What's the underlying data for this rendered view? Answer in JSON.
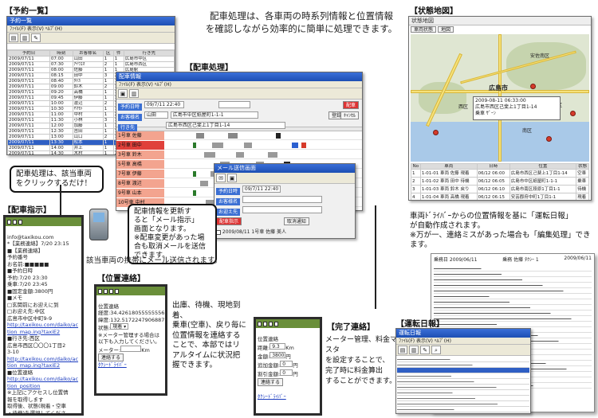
{
  "headline": {
    "line1": "配車処理は、各車両の時系列情報と位置情報",
    "line2": "を確認しながら効率的に簡単に処理できます。"
  },
  "sections": {
    "reservation_list": "【予約一覧】",
    "dispatch": "【配車処理】",
    "status_map": "【状態地図】",
    "dispatch_instruction": "【配車指示】",
    "location_contact": "【位置連絡】",
    "completion_contact": "【完了連絡】",
    "driving_log": "【運転日報】"
  },
  "reservation_window": {
    "title": "予約一覧",
    "menu": "ﾌｧｲﾙ(F) 表示(V) ﾍﾙﾌﾟ(H)",
    "columns": [
      "予約日",
      "時刻",
      "お客様名",
      "区",
      "件",
      "行き先"
    ],
    "rows": [
      [
        "2009/07/11",
        "07:00",
        "山田",
        "1",
        "1",
        "広島市中区"
      ],
      [
        "2009/07/11",
        "07:30",
        "ｱｲｳｴｵ",
        "2",
        "1",
        "広島市西区"
      ],
      [
        "2009/07/11",
        "08:00",
        "佐藤",
        "1",
        "1",
        "広島駅"
      ],
      [
        "2009/07/11",
        "08:15",
        "田中",
        "3",
        "2",
        "広島市南区"
      ],
      [
        "2009/07/11",
        "08:40",
        "ﾀﾅｶ",
        "1",
        "1",
        "広島市東区"
      ],
      [
        "2009/07/11",
        "09:00",
        "鈴木",
        "2",
        "1",
        "広島市中区"
      ],
      [
        "2009/07/11",
        "09:20",
        "高橋",
        "1",
        "1",
        "広島市安佐南区"
      ],
      [
        "2009/07/11",
        "09:45",
        "伊藤",
        "1",
        "1",
        "広島市西区"
      ],
      [
        "2009/07/11",
        "10:00",
        "渡辺",
        "2",
        "1",
        "広島市中区"
      ],
      [
        "2009/07/11",
        "10:30",
        "ﾔﾏﾓﾄ",
        "1",
        "1",
        "広島市南区"
      ],
      [
        "2009/07/11",
        "11:00",
        "中村",
        "1",
        "2",
        "広島市中区"
      ],
      [
        "2009/07/11",
        "11:30",
        "小林",
        "3",
        "1",
        "広島市東区"
      ],
      [
        "2009/07/11",
        "12:00",
        "加藤",
        "1",
        "1",
        "広島駅"
      ],
      [
        "2009/07/11",
        "12:30",
        "吉田",
        "1",
        "1",
        "広島市西区"
      ],
      [
        "2009/07/11",
        "13:00",
        "山口",
        "2",
        "1",
        "広島市中区"
      ],
      [
        "2009/07/11",
        "13:30",
        "松本",
        "1",
        "1",
        "広島市南区"
      ],
      [
        "2009/07/11",
        "14:00",
        "井上",
        "1",
        "1",
        "広島市中区"
      ],
      [
        "2009/07/11",
        "14:30",
        "木村",
        "1",
        "2",
        "広島市安佐北区"
      ]
    ]
  },
  "dispatch_window": {
    "title": "配車情報",
    "menu": "ﾌｧｲﾙ(F) 表示(V) ﾍﾙﾌﾟ(H)",
    "date_label": "予約日時",
    "date_value": "09/7/11 22:40",
    "field_customer": "お客様名",
    "field_from": "お迎え先",
    "field_to": "行き先",
    "customer_value": "山田",
    "from_value": "広島市中区紙屋町1-1-1",
    "to_value": "広島市西区己斐上1丁目1-14",
    "btn_dispatch": "配車",
    "btn_save": "登録",
    "btn_cancel": "ｷｬﾝｾﾙ",
    "vehicles": [
      "1号車 佐藤",
      "2号車 田中",
      "3号車 鈴木",
      "5号車 高橋",
      "7号車 伊藤",
      "8号車 渡辺",
      "9号車 山本",
      "10号車 中村"
    ]
  },
  "mail_window": {
    "title": "メール送信画面",
    "date_label": "予約日時",
    "date_value": "09/7/11 22:40",
    "customer_label": "お客様名",
    "from_label": "お迎え先",
    "to_label": "行き先",
    "send_button": "配車指示",
    "cancel_button": "取消通知",
    "recipient": "2009/08/11 1号車 佐藤 美人"
  },
  "callout_click": {
    "line1": "配車処理は、該当車両",
    "line2": "をクリックするだけ！"
  },
  "callout_mail": {
    "line1": "配車情報を更新す",
    "line2": "ると「メール指示」",
    "line3": "画面となります。",
    "line4": "※配車変更があった場",
    "line5": "合も取消メールを送信",
    "line6": "できます。"
  },
  "phone_send_note": "該当車両の携帯にメール送信されます。",
  "phone_instruction": {
    "sender": "info@taxikou.com",
    "date": "*【業務連絡】7/20 23:15",
    "body": "■【業務連絡】\n予約番号\nお名前:■■■■■\n■予約日時\n予約:7/20 23:30\n乗車:7/20 23:45\n■固定金額:3800円\n■メモ\n□玄関前にお迎えに到\n□お迎え先:中区\n広島市中区中町9-9",
    "link1": "http://taxikou.com/daiko/action_map.ing?taxiE2",
    "note1": "■行き先:西区\n広島市西区〇〇〇1丁目2\n3-10\n",
    "link2": "http://taxikou.com/daiko/action_map.ing?taxiE2",
    "note2": "■位置連絡\n",
    "link3": "http://taxikou.com/daiko/action_position",
    "note3": "※上記にアクセスし位置情\n報を取得します\n取得後、状態(現着・空車\n・待機)を選択してくださ"
  },
  "phone_location": {
    "title": "位置連絡",
    "coords": "経度:34.42618055555556\n緯度:132.5172247906887",
    "status_label": "状態:",
    "status_value": "現着",
    "note": "※メーター管理する場合は\n以下も入力してください。",
    "meter_label": "メーター:",
    "meter_unit": "Km",
    "send": "連絡する",
    "footer": "ﾀｸｼｰﾄﾞﾗｲﾊﾞｰ"
  },
  "location_desc": {
    "line1": "出庫、待機、現地到着、",
    "line2": "乗車(空車)、戻り毎に",
    "line3": "位置情報を連絡する",
    "line4": "ことで、本部ではリ",
    "line5": "アルタイムに状況把",
    "line6": "握できます。"
  },
  "phone_complete": {
    "title": "位置連絡",
    "distance_label": "距離:",
    "distance_value": "9.3",
    "distance_unit": "Km",
    "fare_label": "金額:",
    "fare_value": "3800",
    "fare_unit": "円",
    "extra_label": "追加金額:",
    "extra_value": "0",
    "extra_unit": "円",
    "discount_label": "割引金額:",
    "discount_value": "0",
    "discount_unit": "円",
    "send": "連絡する",
    "footer": "ﾀｸｼｰﾄﾞﾗｲﾊﾞｰ"
  },
  "complete_desc": {
    "line1": "メーター管理、料金マスタ",
    "line2": "を設定することで、",
    "line3": "完了時に料金算出",
    "line4": "することができます。"
  },
  "map_window": {
    "title": "状態地図",
    "tab1": "車両状態",
    "tab2": "地図",
    "popup_date": "2009-08-11 06:33:00",
    "popup_addr": "広島市西区己斐上1丁目1-14",
    "popup_status": "乗車 ｻﾞｰﾝ",
    "places": [
      "広島市",
      "安佐南区",
      "西区",
      "中区",
      "南区",
      "東区"
    ],
    "table_headers": [
      "No",
      "車両",
      "日時",
      "位置",
      "状態"
    ],
    "table_rows": [
      [
        "1",
        "1-01-01 車両 佐藤 現着",
        "06/12 06:00",
        "広島市西区己斐上1丁目1-14",
        "空車"
      ],
      [
        "2",
        "1-01-02 車両 田中 待機",
        "06/12 06:05",
        "広島市中区紙屋町1-1-1",
        "乗車"
      ],
      [
        "3",
        "1-01-03 車両 鈴木 戻り",
        "06/12 06:10",
        "広島市南区段原1丁目1-1",
        "待機"
      ],
      [
        "4",
        "1-01-04 車両 高橋 現着",
        "06/12 06:15",
        "安芸郡府中町1丁目1-1",
        "現着"
      ]
    ]
  },
  "log_desc": {
    "line1": "車両ﾄﾞﾗｲﾊﾞｰからの位置情報を基に「運転日報」",
    "line2": "が自動作成されます。",
    "line3": "※万が一、連絡ミスがあった場合も「編集処理」でき",
    "line4": "ます。"
  },
  "driving_log_doc": {
    "title": "運転日報",
    "header_left": "乗務日 2009/06/11",
    "header_mid": "乗務 佐藤 ﾀｸｼｰ 1",
    "header_right": "2009/06/11"
  },
  "log_window": {
    "title": "運転日報",
    "menu": "ﾌｧｲﾙ(F) 表示(V) ﾍﾙﾌﾟ(H)"
  }
}
